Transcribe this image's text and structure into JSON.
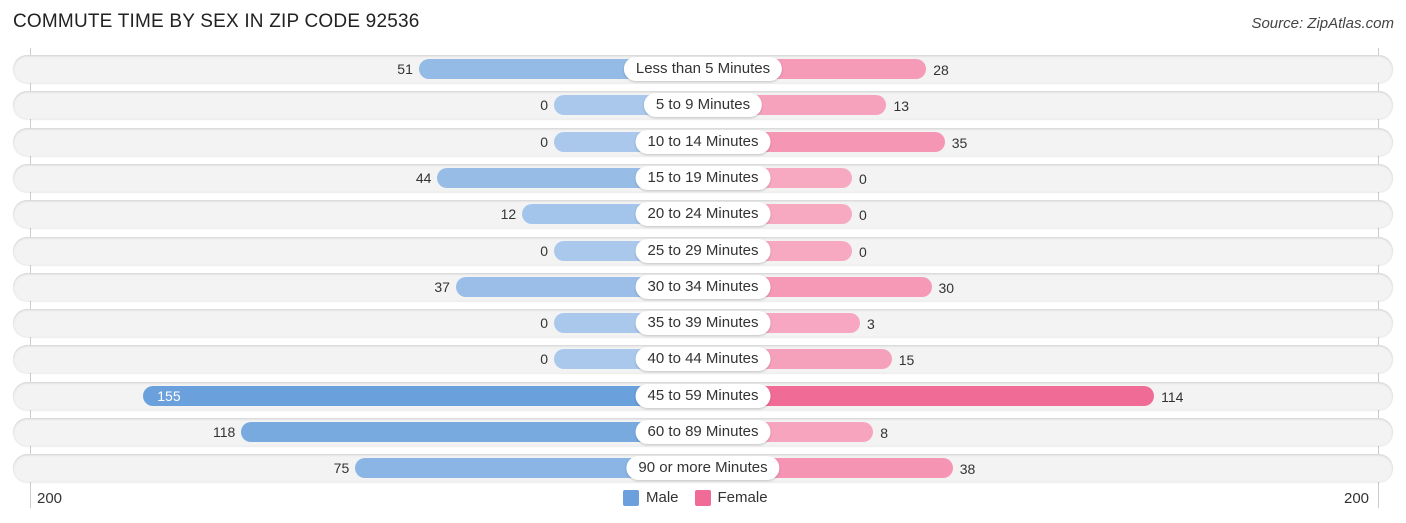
{
  "title": "COMMUTE TIME BY SEX IN ZIP CODE 92536",
  "source": "Source: ZipAtlas.com",
  "colors": {
    "male": "#6aa0db",
    "male_light": "#a9c8ec",
    "female": "#f06b96",
    "female_light": "#f7a9c2"
  },
  "chart_data": {
    "type": "bar",
    "orientation": "horizontal-diverging",
    "title": "COMMUTE TIME BY SEX IN ZIP CODE 92536",
    "categories": [
      "Less than 5 Minutes",
      "5 to 9 Minutes",
      "10 to 14 Minutes",
      "15 to 19 Minutes",
      "20 to 24 Minutes",
      "25 to 29 Minutes",
      "30 to 34 Minutes",
      "35 to 39 Minutes",
      "40 to 44 Minutes",
      "45 to 59 Minutes",
      "60 to 89 Minutes",
      "90 or more Minutes"
    ],
    "series": [
      {
        "name": "Male",
        "values": [
          51,
          0,
          0,
          44,
          12,
          0,
          37,
          0,
          0,
          155,
          118,
          75
        ]
      },
      {
        "name": "Female",
        "values": [
          28,
          13,
          35,
          0,
          0,
          0,
          30,
          3,
          15,
          114,
          8,
          38
        ]
      }
    ],
    "xlim": [
      -200,
      200
    ],
    "tick_labels": {
      "left": "200",
      "right": "200"
    },
    "legend": [
      "Male",
      "Female"
    ],
    "legend_position": "bottom-center"
  }
}
